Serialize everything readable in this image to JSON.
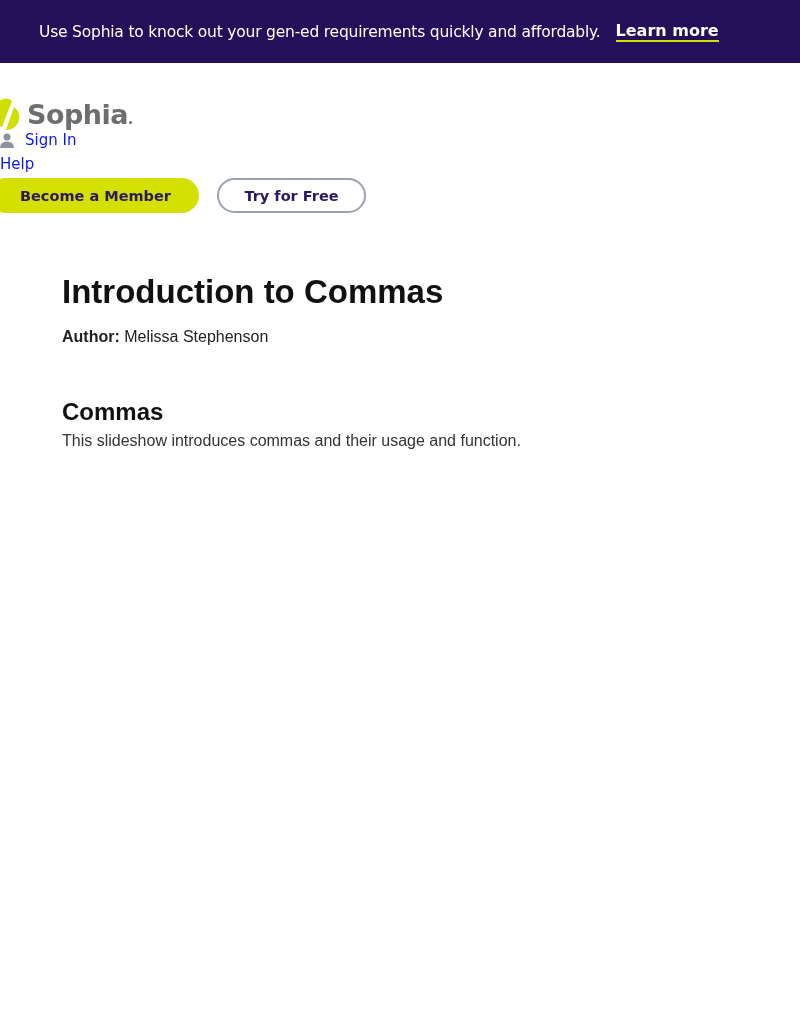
{
  "banner": {
    "message": "Use Sophia to knock out your gen-ed requirements quickly and affordably.",
    "link": "Learn more"
  },
  "header": {
    "logo": "Sophia",
    "sign_in": "Sign In",
    "help": "Help",
    "buttons": [
      {
        "label": "Become a Member",
        "kind": "primary"
      },
      {
        "label": "Try for Free",
        "kind": "outline"
      }
    ]
  },
  "article": {
    "title": "Introduction to Commas",
    "author_label": "Author:",
    "author": "Melissa Stephenson",
    "section_title": "Commas",
    "description": "This slideshow introduces commas and their usage and function."
  }
}
